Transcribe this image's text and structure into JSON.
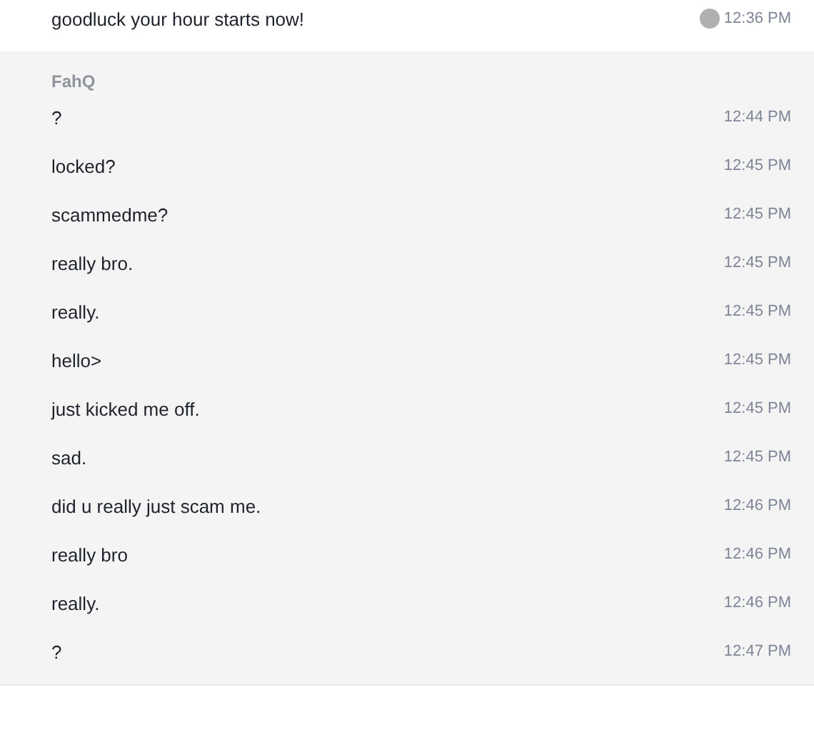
{
  "groups": [
    {
      "kind": "own",
      "messages": [
        {
          "text": "goodluck your hour starts now!",
          "time": "12:36 PM",
          "seen": true
        }
      ]
    },
    {
      "kind": "other",
      "sender": "FahQ",
      "messages": [
        {
          "text": "?",
          "time": "12:44 PM"
        },
        {
          "text": "locked?",
          "time": "12:45 PM"
        },
        {
          "text": "scammedme?",
          "time": "12:45 PM"
        },
        {
          "text": "really bro.",
          "time": "12:45 PM"
        },
        {
          "text": "really.",
          "time": "12:45 PM"
        },
        {
          "text": "hello>",
          "time": "12:45 PM"
        },
        {
          "text": "just kicked me off.",
          "time": "12:45 PM"
        },
        {
          "text": "sad.",
          "time": "12:45 PM"
        },
        {
          "text": "did u really just scam me.",
          "time": "12:46 PM"
        },
        {
          "text": "really bro",
          "time": "12:46 PM"
        },
        {
          "text": "really.",
          "time": "12:46 PM"
        },
        {
          "text": "?",
          "time": "12:47 PM"
        }
      ]
    }
  ]
}
